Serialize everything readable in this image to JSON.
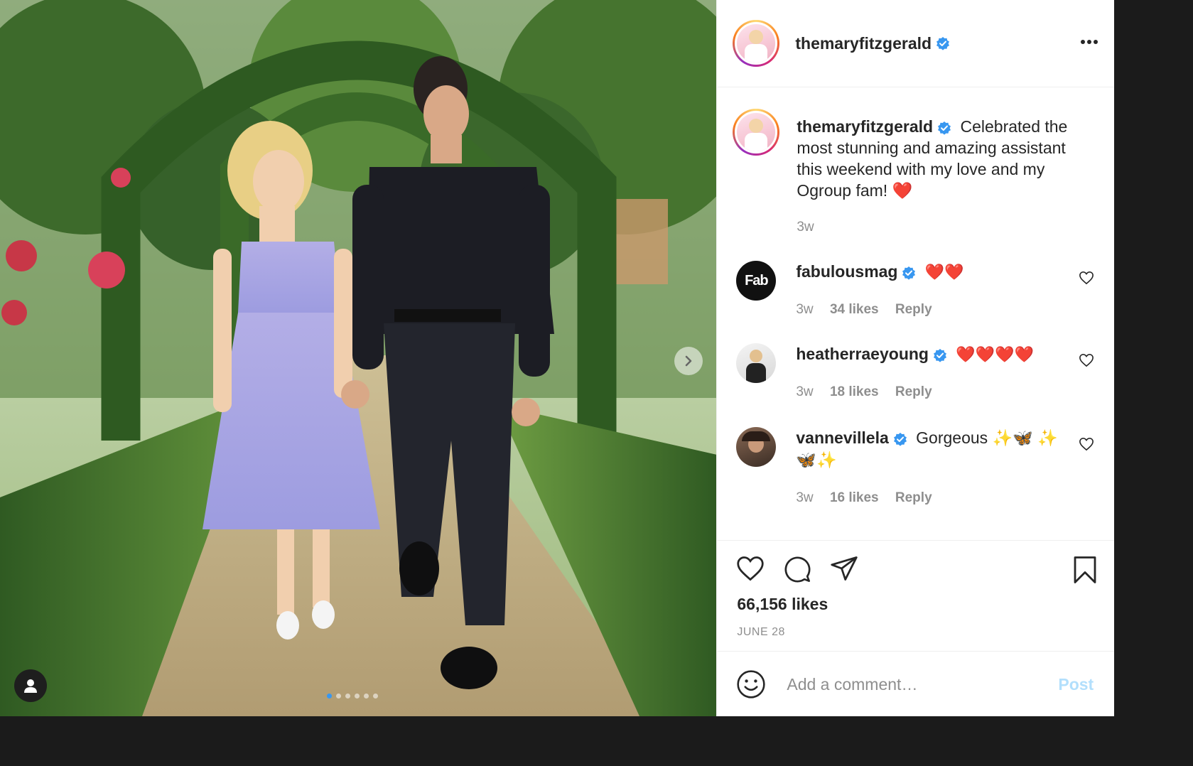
{
  "post": {
    "author": "themaryfitzgerald",
    "caption": "Celebrated the most stunning and amazing assistant this weekend with my love and my Ogroup fam! ❤️",
    "caption_time": "3w",
    "likes": "66,156 likes",
    "date": "JUNE 28",
    "carousel": {
      "total": 6,
      "active_index": 0
    }
  },
  "comments": [
    {
      "user": "fabulousmag",
      "avatar_text": "Fab",
      "text": "❤️❤️",
      "time": "3w",
      "likes": "34 likes",
      "reply": "Reply"
    },
    {
      "user": "heatherraeyoung",
      "text": "❤️❤️❤️❤️",
      "time": "3w",
      "likes": "18 likes",
      "reply": "Reply"
    },
    {
      "user": "vannevillela",
      "text": "Gorgeous ✨🦋 ✨🦋✨",
      "time": "3w",
      "likes": "16 likes",
      "reply": "Reply"
    }
  ],
  "composer": {
    "placeholder": "Add a comment…",
    "post_label": "Post"
  },
  "colors": {
    "verified": "#3897f0",
    "post_button_disabled": "#b2dffc",
    "muted": "#8e8e8e",
    "text": "#262626"
  },
  "icons": [
    "verified-badge-icon",
    "more-options-icon",
    "heart-icon",
    "comment-icon",
    "share-icon",
    "bookmark-icon",
    "emoji-icon",
    "chevron-right-icon",
    "user-tag-icon"
  ]
}
